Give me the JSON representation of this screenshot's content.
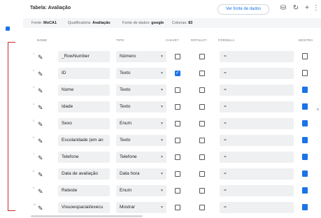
{
  "header": {
    "title": "Tabela: Avaliação",
    "view_source_label": "Ver fonte de dados",
    "icons": [
      "database-gear-icon",
      "refresh-icon",
      "add-icon",
      "more-vert-icon"
    ]
  },
  "info": {
    "source_label": "Fonte:",
    "source_value": "MoCA1",
    "qualifier_label": "Qualificatória:",
    "qualifier_value": "Avaliação",
    "datasource_label": "Fonte de dados:",
    "datasource_value": "google",
    "columns_label": "Colunas:",
    "columns_value": "83"
  },
  "columns": {
    "name": "NOME",
    "type": "TIPO",
    "key": "CHAVE?",
    "label": "RÓTULO?",
    "formula": "FÓRMULA",
    "show": "MOSTRA"
  },
  "rows": [
    {
      "num": "1",
      "name": "_RowNumber",
      "type": "Número",
      "key": false,
      "label": false,
      "formula": "=",
      "show": false
    },
    {
      "num": "2",
      "name": "ID",
      "type": "Texto",
      "key": true,
      "label": false,
      "formula": "=",
      "show": false
    },
    {
      "num": "3",
      "name": "Nome",
      "type": "Texto",
      "key": false,
      "label": false,
      "formula": "=",
      "show": true
    },
    {
      "num": "4",
      "name": "Idade",
      "type": "Texto",
      "key": false,
      "label": false,
      "formula": "=",
      "show": true
    },
    {
      "num": "5",
      "name": "Sexo",
      "type": "Enum",
      "key": false,
      "label": false,
      "formula": "=",
      "show": true
    },
    {
      "num": "6",
      "name": "Escolaridade (em an",
      "type": "Texto",
      "key": false,
      "label": false,
      "formula": "=",
      "show": true
    },
    {
      "num": "7",
      "name": "Telefone",
      "type": "Telefone",
      "key": false,
      "label": false,
      "formula": "=",
      "show": true
    },
    {
      "num": "8",
      "name": "Data de avaliação",
      "type": "Data hora",
      "key": false,
      "label": false,
      "formula": "=",
      "show": true
    },
    {
      "num": "9",
      "name": "Reteste",
      "type": "Enum",
      "key": false,
      "label": false,
      "formula": "=",
      "show": true
    },
    {
      "num": "10",
      "name": "Visuoespacial/execu",
      "type": "Mostrar",
      "key": false,
      "label": false,
      "formula": "=",
      "show": true
    }
  ],
  "colors": {
    "accent": "#1a73e8",
    "bracket": "#c62828"
  }
}
